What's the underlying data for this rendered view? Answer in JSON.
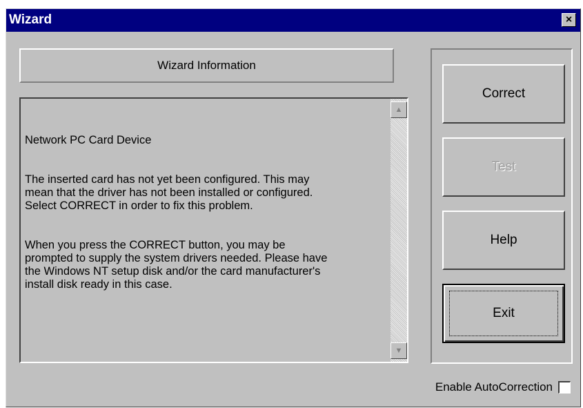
{
  "window": {
    "title": "Wizard",
    "close_glyph": "×",
    "title_bar_color": "#000080"
  },
  "info": {
    "header": "Wizard Information",
    "paragraphs": [
      "Network PC Card Device",
      "The inserted card has not yet been configured.  This may\nmean that the driver has not been installed or configured.\nSelect CORRECT in order to fix this problem.",
      "When you press the CORRECT button, you may be\nprompted to supply the system drivers needed.  Please have\nthe Windows NT setup disk and/or the card manufacturer's\ninstall disk ready in this case."
    ]
  },
  "scrollbar": {
    "up_icon": "▲",
    "down_icon": "▼"
  },
  "buttons": {
    "correct": "Correct",
    "test": "Test",
    "help": "Help",
    "exit": "Exit"
  },
  "options": {
    "autocorrection_label": "Enable AutoCorrection",
    "autocorrection_checked": false
  }
}
